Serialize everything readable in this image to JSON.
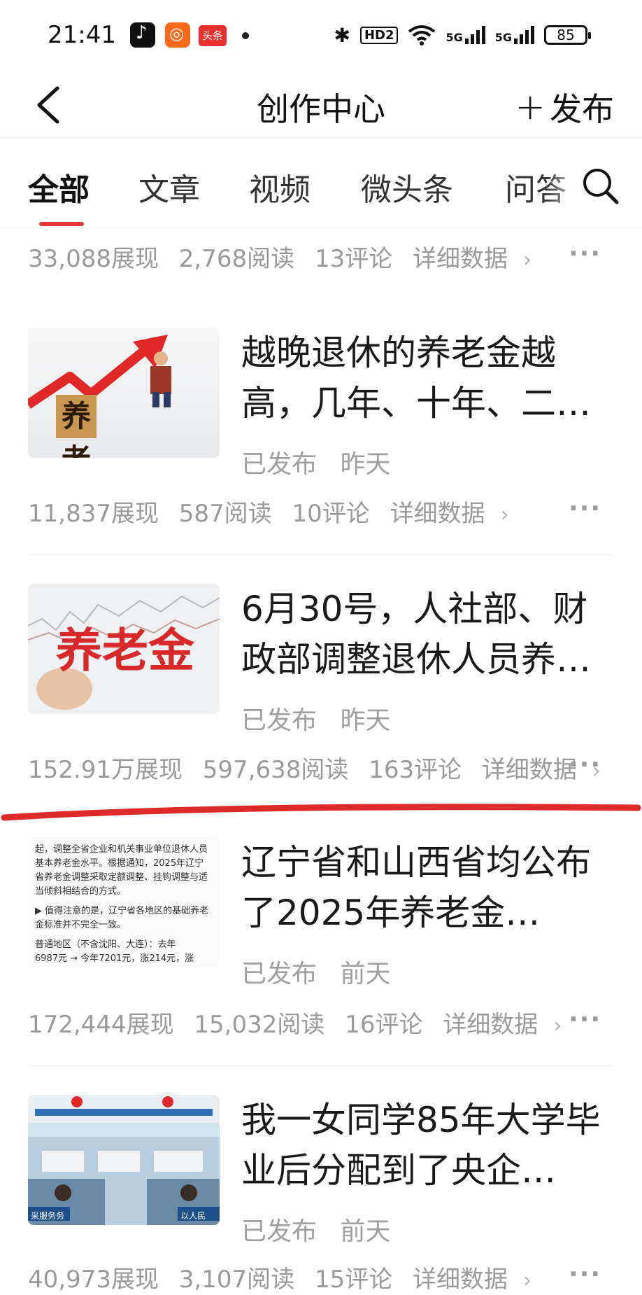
{
  "status_bar": {
    "time": "21:41",
    "toutiao_badge": "头条",
    "hd_label": "HD2",
    "sig1": "5G",
    "sig2": "5G",
    "battery": "85"
  },
  "header": {
    "title": "创作中心",
    "publish_label": "发布"
  },
  "tabs": [
    {
      "label": "全部",
      "active": true
    },
    {
      "label": "文章",
      "active": false
    },
    {
      "label": "视频",
      "active": false
    },
    {
      "label": "微头条",
      "active": false
    },
    {
      "label": "问答",
      "active": false
    }
  ],
  "top_stats": {
    "views": "33,088展现",
    "reads": "2,768阅读",
    "comments": "13评论",
    "detail": "详细数据"
  },
  "articles": [
    {
      "title": "越晚退休的养老金越高，几年、十年、二…",
      "status": "已发布",
      "time": "昨天",
      "thumb_text": "养老金",
      "stats": {
        "views": "11,837展现",
        "reads": "587阅读",
        "comments": "10评论",
        "detail": "详细数据"
      }
    },
    {
      "title": "6月30号，人社部、财政部调整退休人员养…",
      "status": "已发布",
      "time": "昨天",
      "thumb_text": "养老金",
      "stats": {
        "views": "152.91万展现",
        "reads": "597,638阅读",
        "comments": "163评论",
        "detail": "详细数据"
      }
    },
    {
      "title": "辽宁省和山西省均公布了2025年养老金…",
      "status": "已发布",
      "time": "前天",
      "thumb_lines": [
        "起，调整全省企业和机关事业单位退休人员",
        "基本养老金水平。根据通知，2025年辽宁",
        "省养老金调整采取定额调整、挂钩调整与适",
        "当倾斜相结合的方式。",
        "▶ 值得注意的是，辽宁省各地区的基础养老",
        "金标准并不完全一致。",
        "普通地区（不含沈阳、大连）：去年",
        "6987元 → 今年7201元，涨214元，涨"
      ],
      "stats": {
        "views": "172,444展现",
        "reads": "15,032阅读",
        "comments": "16评论",
        "detail": "详细数据"
      }
    },
    {
      "title": "我一女同学85年大学毕业后分配到了央企…",
      "status": "已发布",
      "time": "前天",
      "thumb_signs": [
        "采服务务",
        "以人民"
      ],
      "stats": {
        "views": "40,973展现",
        "reads": "3,107阅读",
        "comments": "15评论",
        "detail": "详细数据"
      }
    }
  ],
  "colors": {
    "accent_red": "#e23a3a",
    "stroke_red": "#dd2b2b",
    "muted_text": "#9a9a9a"
  }
}
